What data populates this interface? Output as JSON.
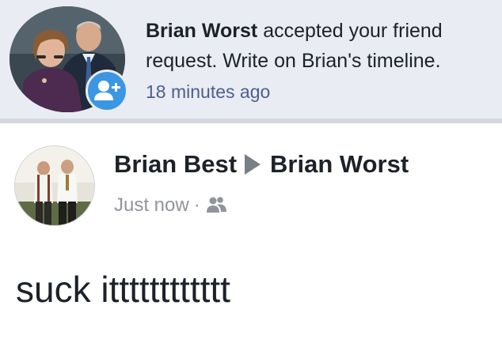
{
  "notification": {
    "actor_name": "Brian Worst",
    "message_part1": "accepted your friend request. Write on Brian's timeline.",
    "time": "18 minutes ago",
    "badge_icon": "add-friend-icon",
    "badge_color": "#3b97e3",
    "background_color": "#e9ecf3"
  },
  "post": {
    "author_name": "Brian Best",
    "separator_icon": "right-triangle-icon",
    "target_name": "Brian Worst",
    "time": "Just now",
    "dot": "·",
    "audience_icon": "friends-icon",
    "text": "suck itttttttttttt"
  }
}
